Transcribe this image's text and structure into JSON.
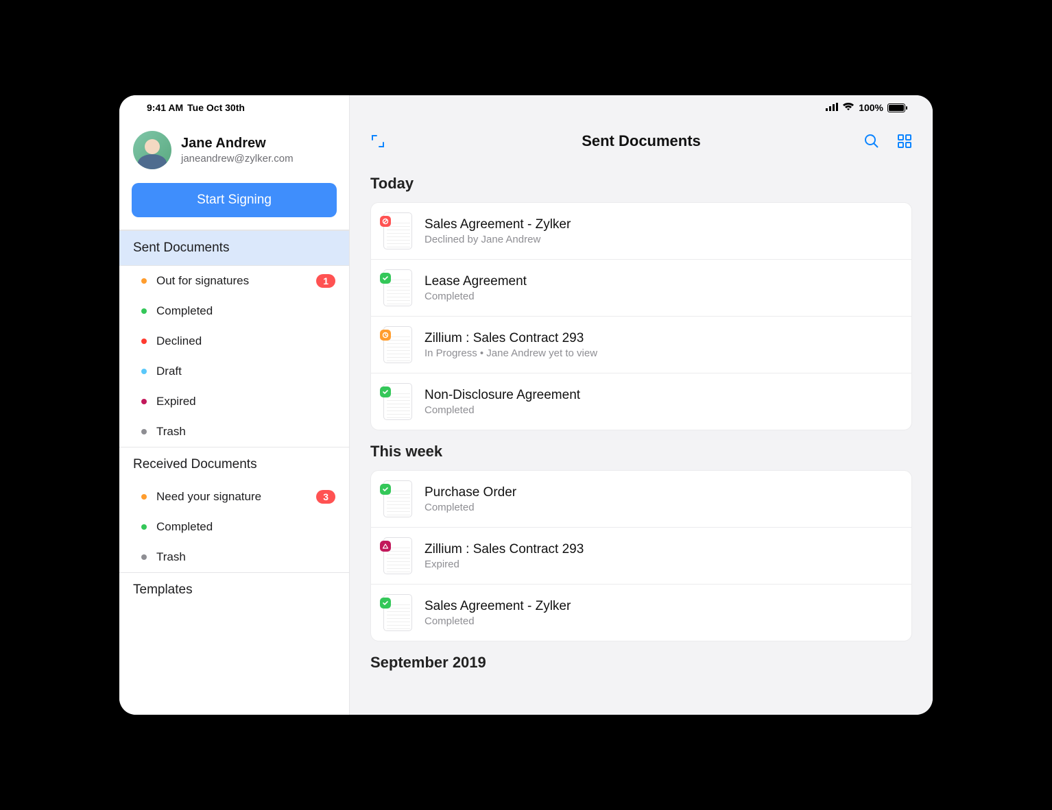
{
  "status_bar": {
    "time": "9:41 AM",
    "date": "Tue Oct 30th",
    "battery_percent": "100%"
  },
  "profile": {
    "name": "Jane Andrew",
    "email": "janeandrew@zylker.com"
  },
  "start_button": "Start Signing",
  "sidebar": {
    "sent_title": "Sent Documents",
    "sent_items": [
      {
        "label": "Out for signatures",
        "dot": "#ff9d2e",
        "badge": "1"
      },
      {
        "label": "Completed",
        "dot": "#34c759"
      },
      {
        "label": "Declined",
        "dot": "#ff3b30"
      },
      {
        "label": "Draft",
        "dot": "#5ac8fa"
      },
      {
        "label": "Expired",
        "dot": "#c2185b"
      },
      {
        "label": "Trash",
        "dot": "#8e8e93"
      }
    ],
    "received_title": "Received Documents",
    "received_items": [
      {
        "label": "Need your signature",
        "dot": "#ff9d2e",
        "badge": "3"
      },
      {
        "label": "Completed",
        "dot": "#34c759"
      },
      {
        "label": "Trash",
        "dot": "#8e8e93"
      }
    ],
    "templates_title": "Templates"
  },
  "main": {
    "title": "Sent Documents",
    "groups": [
      {
        "title": "Today",
        "docs": [
          {
            "title": "Sales Agreement - Zylker",
            "sub": "Declined by Jane Andrew",
            "status_color": "#ff5252",
            "status": "declined"
          },
          {
            "title": "Lease Agreement",
            "sub": "Completed",
            "status_color": "#34c759",
            "status": "completed"
          },
          {
            "title": "Zillium : Sales Contract 293",
            "sub": "In Progress • Jane Andrew yet to view",
            "status_color": "#ff9d2e",
            "status": "progress"
          },
          {
            "title": "Non-Disclosure Agreement",
            "sub": "Completed",
            "status_color": "#34c759",
            "status": "completed"
          }
        ]
      },
      {
        "title": "This week",
        "docs": [
          {
            "title": "Purchase Order",
            "sub": "Completed",
            "status_color": "#34c759",
            "status": "completed"
          },
          {
            "title": "Zillium : Sales Contract 293",
            "sub": "Expired",
            "status_color": "#c2185b",
            "status": "expired"
          },
          {
            "title": "Sales Agreement - Zylker",
            "sub": "Completed",
            "status_color": "#34c759",
            "status": "completed"
          }
        ]
      },
      {
        "title": "September 2019",
        "docs": []
      }
    ]
  }
}
